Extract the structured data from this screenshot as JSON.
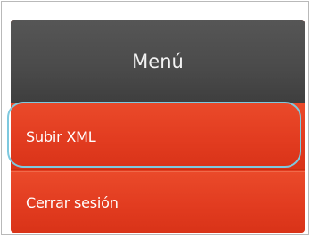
{
  "menu": {
    "header": "Menú",
    "items": [
      {
        "label": "Subir XML"
      },
      {
        "label": "Cerrar sesión"
      }
    ]
  },
  "colors": {
    "header_bg": "#4a4a4a",
    "item_bg": "#e23c20",
    "highlight_outline": "#7ec9df",
    "frame_border": "#b9b9b9"
  }
}
